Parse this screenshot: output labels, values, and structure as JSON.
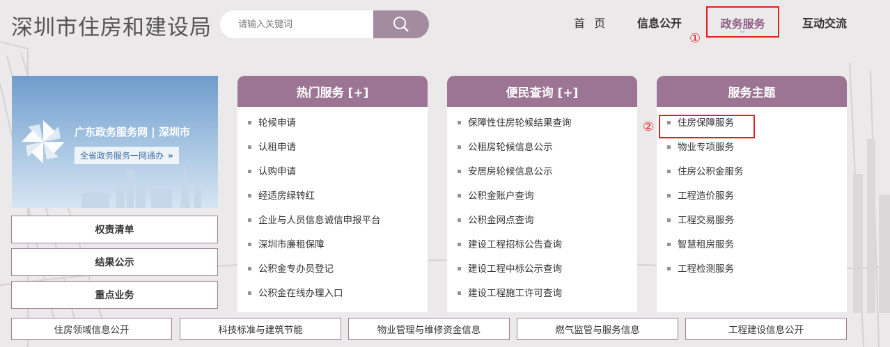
{
  "header": {
    "site_title": "深圳市住房和建设局",
    "search_placeholder": "请输入关键词"
  },
  "nav": {
    "home": "首 页",
    "info": "信息公开",
    "gov_service": "政务服务",
    "interaction": "互动交流"
  },
  "annotations": {
    "step1": "①",
    "step2": "②"
  },
  "banner": {
    "title": "广东政务服务网 | 深圳市",
    "subtitle": "全省政务服务一网通办",
    "arrows": "»"
  },
  "left_buttons": [
    "权责清单",
    "结果公示",
    "重点业务"
  ],
  "panels": {
    "hot": {
      "title": "热门服务 [+]",
      "items": [
        "轮候申请",
        "认租申请",
        "认购申请",
        "经适房绿转红",
        "企业与人员信息诚信申报平台",
        "深圳市廉租保障",
        "公积金专办员登记",
        "公积金在线办理入口"
      ]
    },
    "query": {
      "title": "便民查询 [+]",
      "items": [
        "保障性住房轮候结果查询",
        "公租房轮候信息公示",
        "安居房轮候信息公示",
        "公积金账户查询",
        "公积金网点查询",
        "建设工程招标公告查询",
        "建设工程中标公示查询",
        "建设工程施工许可查询"
      ]
    },
    "topics": {
      "title": "服务主题",
      "items": [
        "住房保障服务",
        "物业专项服务",
        "住房公积金服务",
        "工程造价服务",
        "工程交易服务",
        "智慧租房服务",
        "工程检测服务"
      ]
    }
  },
  "bottom_links": [
    "住房领域信息公开",
    "科技标准与建筑节能",
    "物业管理与维修资金信息",
    "燃气监管与服务信息",
    "工程建设信息公开"
  ],
  "colors": {
    "accent": "#9c7494",
    "highlight": "#e02020",
    "background": "#ece9ea"
  }
}
